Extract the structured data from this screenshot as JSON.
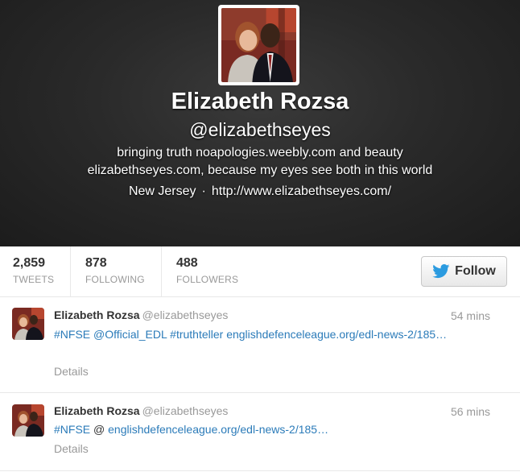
{
  "profile": {
    "name": "Elizabeth Rozsa",
    "handle": "@elizabethseyes",
    "bio_line1": "bringing truth noapologies.weebly.com and beauty",
    "bio_line2": "elizabethseyes.com, because my eyes see both in this world",
    "location": "New Jersey",
    "separator": "·",
    "url": "http://www.elizabethseyes.com/"
  },
  "stats": [
    {
      "value": "2,859",
      "label": "TWEETS"
    },
    {
      "value": "878",
      "label": "FOLLOWING"
    },
    {
      "value": "488",
      "label": "FOLLOWERS"
    }
  ],
  "follow": {
    "label": "Follow",
    "icon": "twitter-bird-icon"
  },
  "tweets": [
    {
      "name": "Elizabeth Rozsa",
      "handle": "@elizabethseyes",
      "time": "54 mins",
      "parts": [
        {
          "text": "#NFSE",
          "link": true
        },
        {
          "text": " ",
          "link": false
        },
        {
          "text": "@Official_EDL",
          "link": true
        },
        {
          "text": " ",
          "link": false
        },
        {
          "text": "#truthteller",
          "link": true
        },
        {
          "text": " ",
          "link": false
        },
        {
          "text": "englishdefenceleague.org/edl-news-2/185…",
          "link": true
        }
      ],
      "details": "Details"
    },
    {
      "name": "Elizabeth Rozsa",
      "handle": "@elizabethseyes",
      "time": "56 mins",
      "parts": [
        {
          "text": "#NFSE",
          "link": true
        },
        {
          "text": " @ ",
          "link": false
        },
        {
          "text": "englishdefenceleague.org/edl-news-2/185…",
          "link": true
        }
      ],
      "details": "Details"
    }
  ],
  "colors": {
    "link": "#2b7bb9",
    "muted": "#999999",
    "twitter_blue": "#2b9be0"
  }
}
